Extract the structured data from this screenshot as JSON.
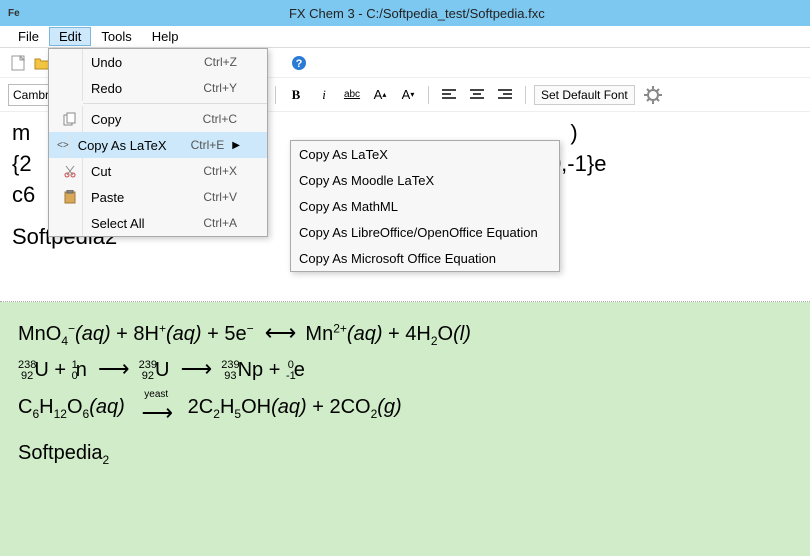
{
  "app_icon": "Fe",
  "title": "FX Chem 3 - C:/Softpedia_test/Softpedia.fxc",
  "menubar": [
    "File",
    "Edit",
    "Tools",
    "Help"
  ],
  "toolbar2": {
    "font": "Cambria",
    "bold": "B",
    "italic": "i",
    "underline": "abc",
    "inc_font": "A",
    "dec_font": "A",
    "set_default": "Set Default Font"
  },
  "edit_menu": [
    {
      "label": "Undo",
      "shortcut": "Ctrl+Z"
    },
    {
      "label": "Redo",
      "shortcut": "Ctrl+Y"
    },
    {
      "sep": true
    },
    {
      "label": "Copy",
      "shortcut": "Ctrl+C"
    },
    {
      "label": "Copy As LaTeX",
      "shortcut": "Ctrl+E",
      "hover": true,
      "sub": true
    },
    {
      "label": "Cut",
      "shortcut": "Ctrl+X"
    },
    {
      "label": "Paste",
      "shortcut": "Ctrl+V"
    },
    {
      "label": "Select All",
      "shortcut": "Ctrl+A"
    }
  ],
  "sub_menu": [
    "Copy As LaTeX",
    "Copy As Moodle LaTeX",
    "Copy As MathML",
    "Copy As LibreOffice/OpenOffice Equation",
    "Copy As Microsoft Office Equation"
  ],
  "editor": {
    "l1_left": "m",
    "l1_right": ")",
    "l2_left": "{2",
    "l2_right": "{0,-1}e",
    "l3_left": "c6",
    "l4": "Softpedia2"
  },
  "output": {
    "line1": "MnO₄⁻(aq) + 8H⁺(aq) + 5e⁻  ⟷  Mn²⁺(aq) + 4H₂O(l)",
    "line2": "²³⁸₉₂U + ¹₀n  ⟶  ²³⁹₉₂U  ⟶  ²³⁹₉₃Np + ⁰₋₁e",
    "line3_left": "C₆H₁₂O₆(aq)",
    "line3_yeast": "yeast",
    "line3_right": "2C₂H₅OH(aq) + 2CO₂(g)",
    "line4": "Softpedia₂"
  }
}
